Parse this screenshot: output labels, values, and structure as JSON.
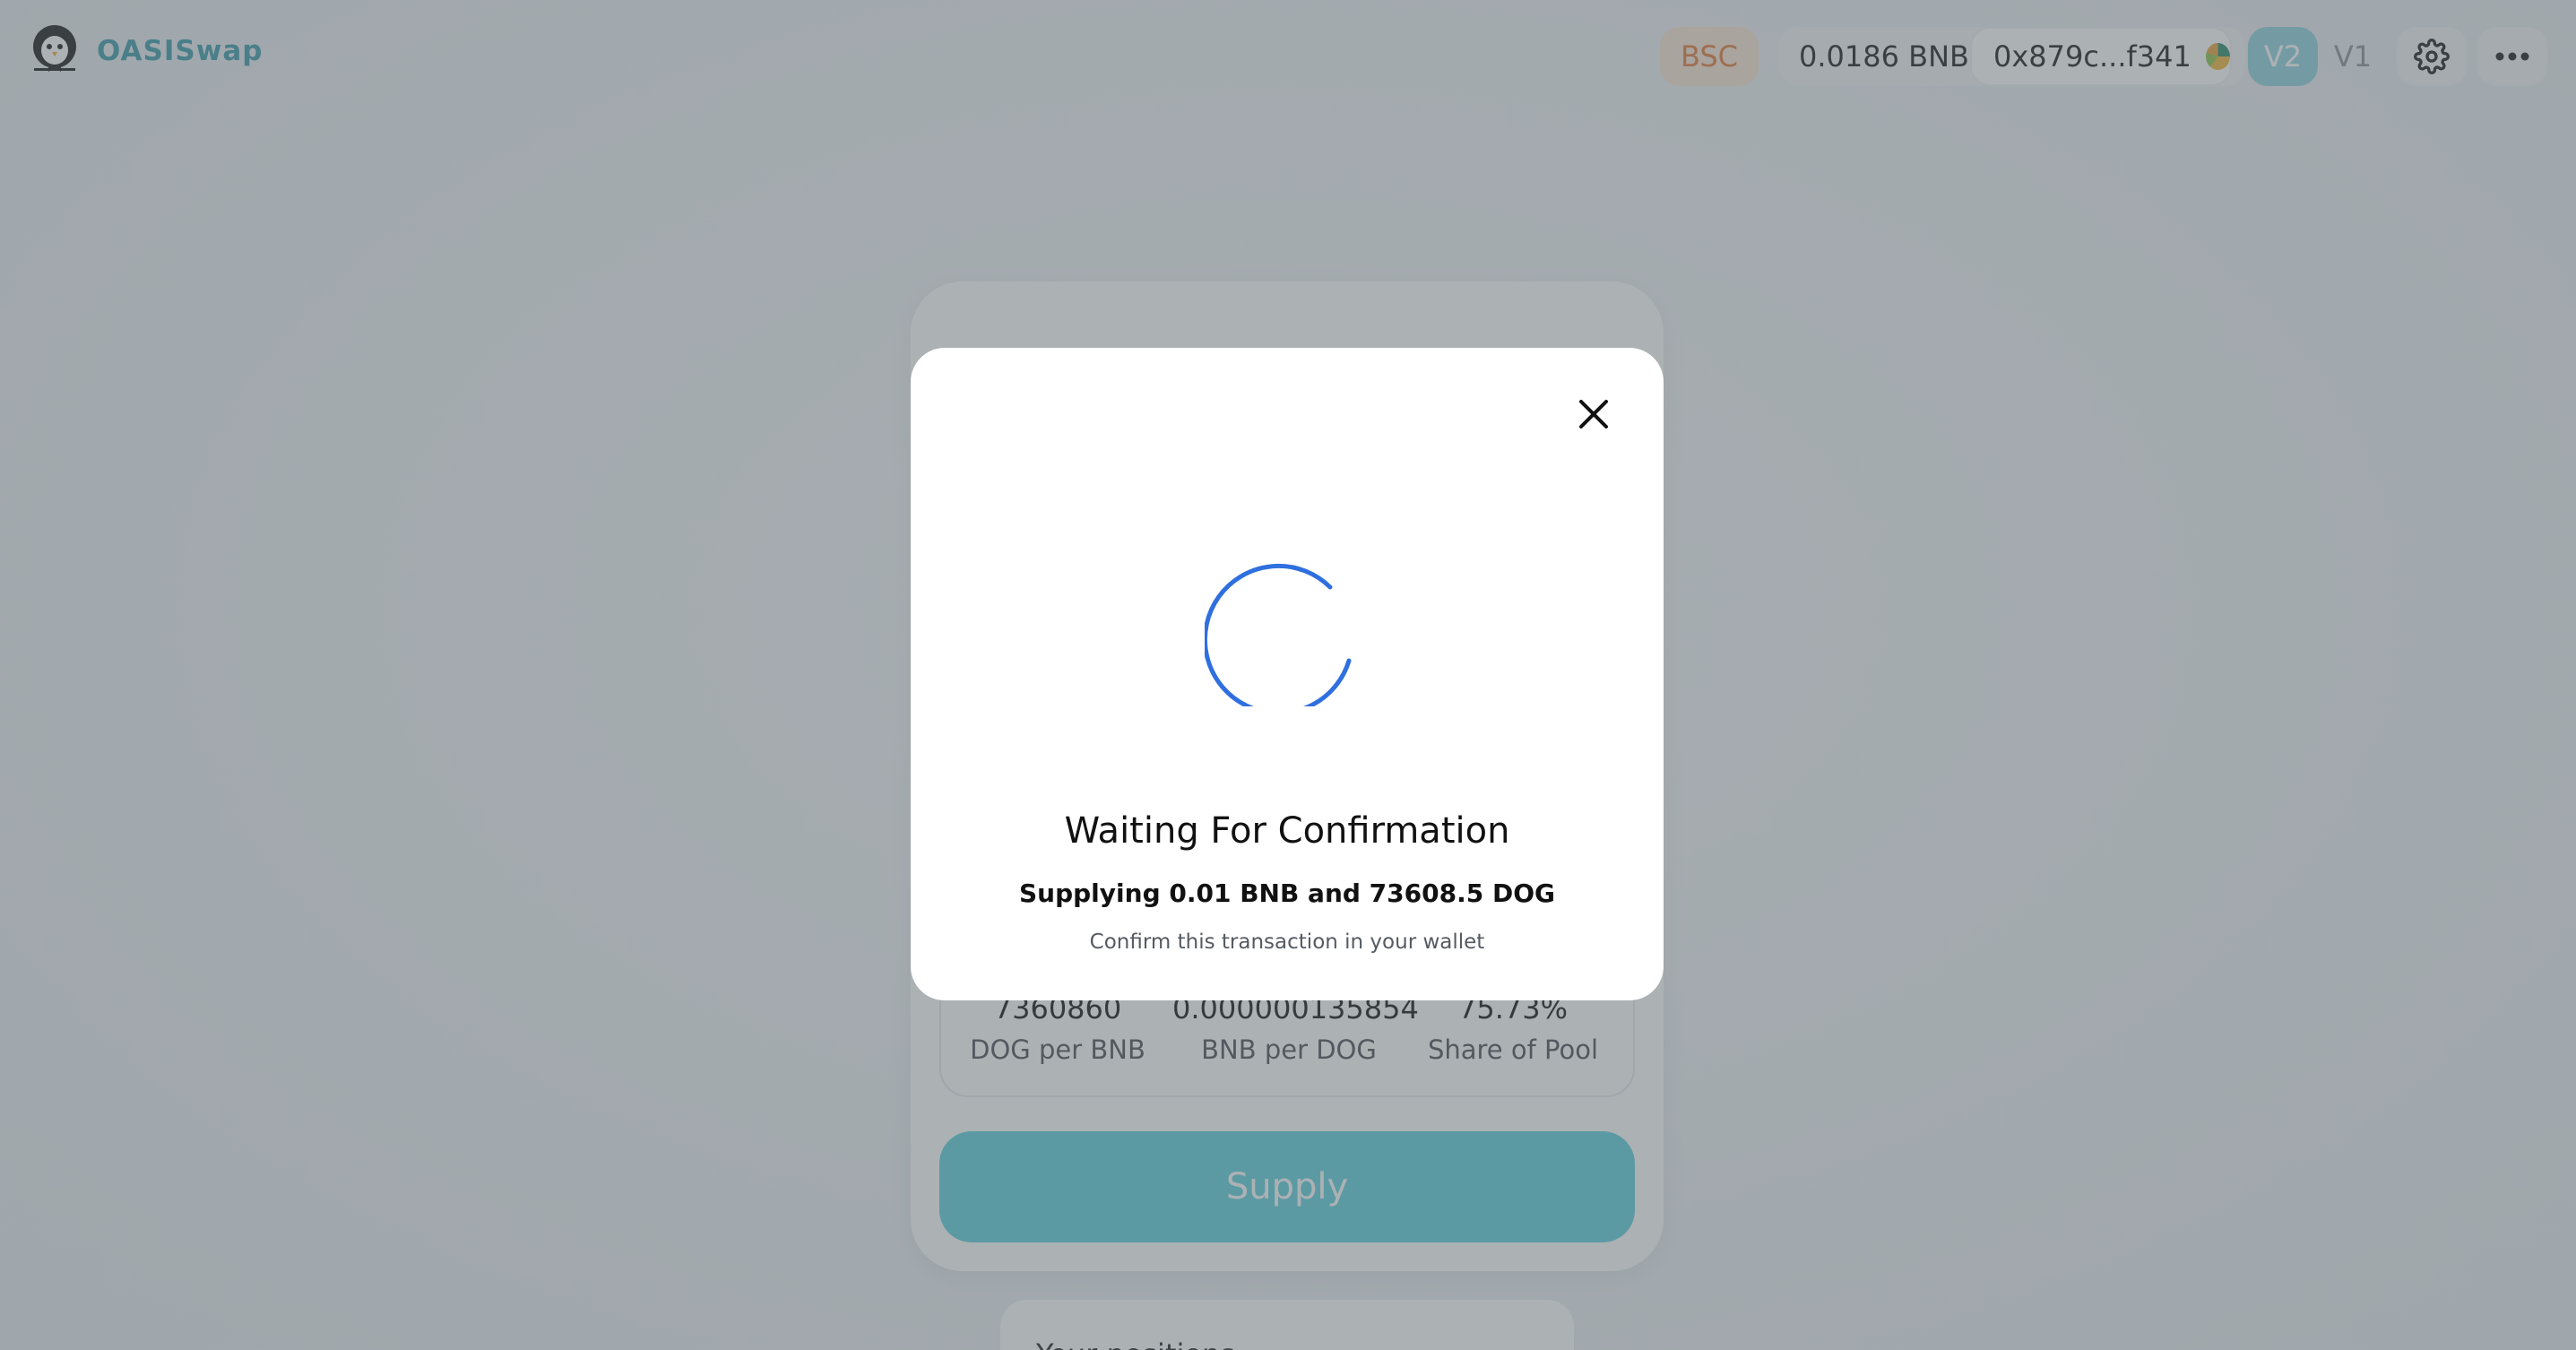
{
  "header": {
    "logo_text": "OASISwap",
    "chain": "BSC",
    "balance": "0.0186 BNB",
    "account": "0x879c...f341",
    "version_active": "V2",
    "version_inactive": "V1",
    "settings_icon": "gear-icon",
    "more_icon": "more-dots-icon"
  },
  "card": {
    "stats": [
      {
        "value": "7360860",
        "label": "DOG per BNB"
      },
      {
        "value": "0.000000135854",
        "label": "BNB per DOG"
      },
      {
        "value": "75.73%",
        "label": "Share of Pool"
      }
    ],
    "supply_label": "Supply",
    "positions_label": "Your positions"
  },
  "modal": {
    "title": "Waiting For Confirmation",
    "subtitle": "Supplying 0.01 BNB and 73608.5 DOG",
    "hint": "Confirm this transaction in your wallet",
    "close_icon": "close-icon",
    "spinner_color": "#2f6fdf"
  },
  "colors": {
    "brand": "#3a9aa8",
    "supply_button": "#5fd0dc",
    "chain_pill_bg": "#fbe5d5",
    "chain_pill_text": "#e07b39",
    "v2_pill_bg": "#8fd3dc"
  }
}
